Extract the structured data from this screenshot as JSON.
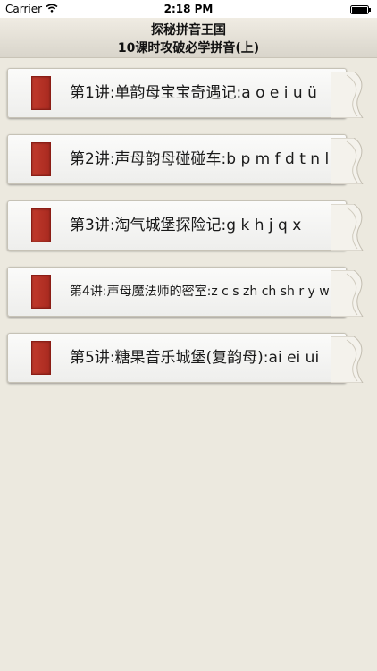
{
  "status_bar": {
    "carrier": "Carrier",
    "time": "2:18 PM"
  },
  "header": {
    "title": "探秘拼音王国",
    "subtitle": "10课时攻破必学拼音(上)"
  },
  "lessons": [
    {
      "label": "第1讲:单韵母宝宝奇遇记:a o e i u ü"
    },
    {
      "label": "第2讲:声母韵母碰碰车:b p m f d t n l"
    },
    {
      "label": "第3讲:淘气城堡探险记:g k h j q x"
    },
    {
      "label": "第4讲:声母魔法师的密室:z c s zh ch sh r y w"
    },
    {
      "label": "第5讲:糖果音乐城堡(复韵母):ai ei ui"
    }
  ],
  "colors": {
    "background": "#ece9df",
    "bookmark": "#c0392b"
  }
}
